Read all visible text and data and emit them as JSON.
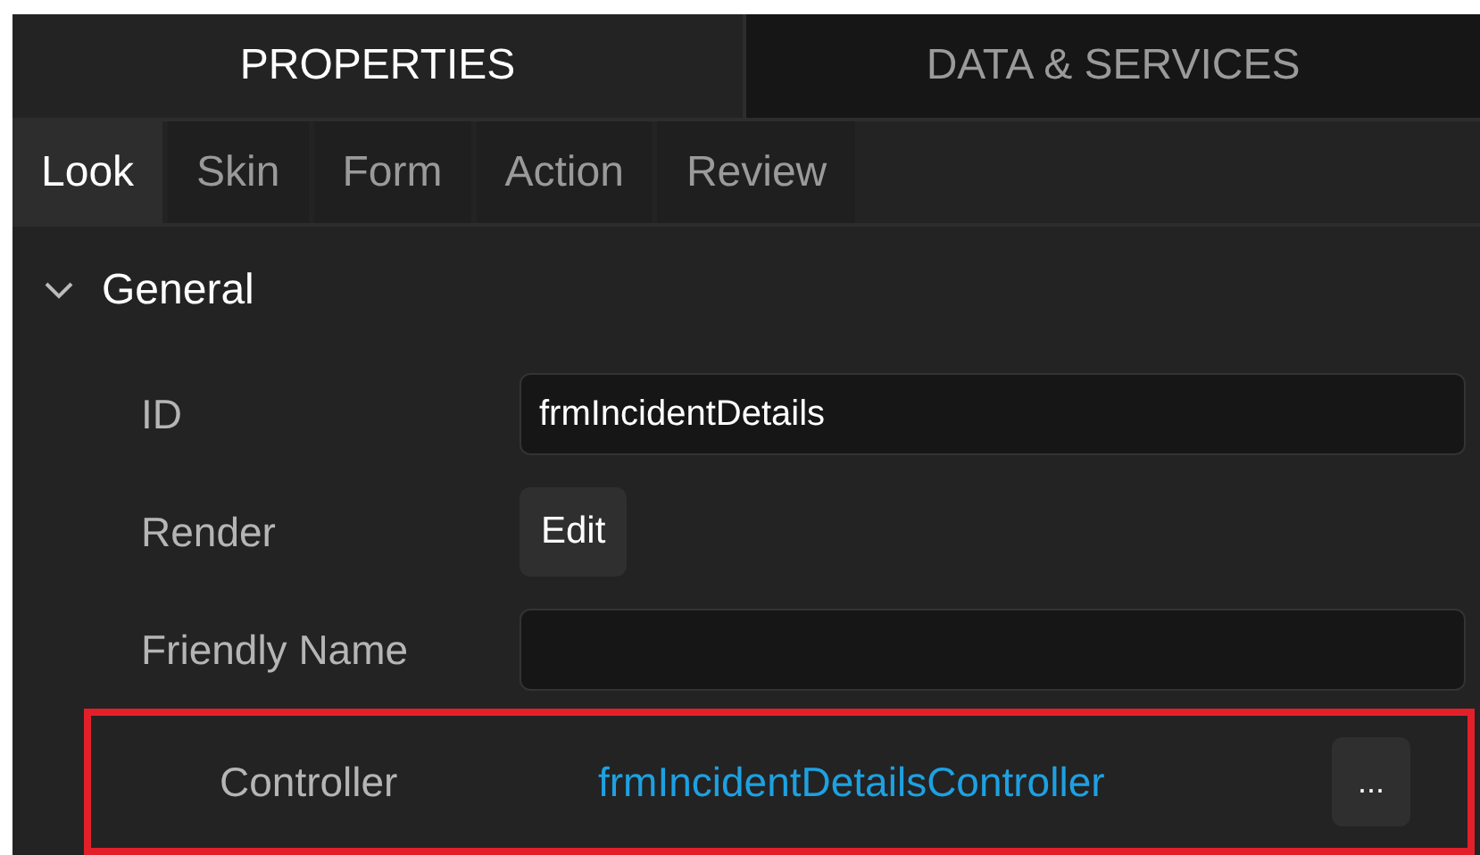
{
  "panel_tabs": [
    {
      "label": "PROPERTIES",
      "selected": true
    },
    {
      "label": "DATA & SERVICES",
      "selected": false
    }
  ],
  "sub_tabs": [
    {
      "label": "Look",
      "selected": true
    },
    {
      "label": "Skin",
      "selected": false
    },
    {
      "label": "Form",
      "selected": false
    },
    {
      "label": "Action",
      "selected": false
    },
    {
      "label": "Review",
      "selected": false
    }
  ],
  "section": {
    "title": "General",
    "expanded": true,
    "properties": [
      {
        "kind": "field",
        "label": "ID",
        "value": "frmIncidentDetails",
        "highlighted": false
      },
      {
        "kind": "button",
        "label": "Render",
        "button": "Edit",
        "highlighted": false
      },
      {
        "kind": "field",
        "label": "Friendly Name",
        "highlighted": false
      },
      {
        "kind": "link",
        "label": "Controller",
        "value": "frmIncidentDetailsController",
        "button": "...",
        "highlighted": true
      }
    ]
  }
}
